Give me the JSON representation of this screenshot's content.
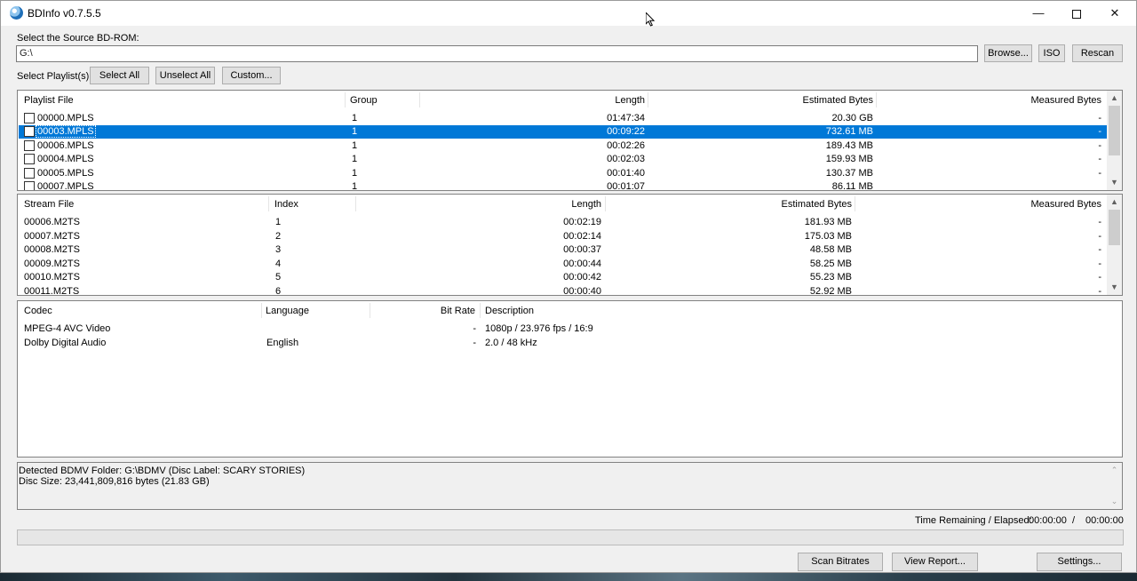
{
  "window": {
    "title": "BDInfo v0.7.5.5"
  },
  "source": {
    "label": "Select the Source BD-ROM:",
    "path": "G:\\",
    "browse_label": "Browse...",
    "iso_label": "ISO",
    "rescan_label": "Rescan"
  },
  "playlist_select": {
    "label": "Select Playlist(s):",
    "select_all": "Select All",
    "unselect_all": "Unselect All",
    "custom": "Custom..."
  },
  "playlists": {
    "headers": [
      "Playlist File",
      "Group",
      "Length",
      "Estimated Bytes",
      "Measured Bytes"
    ],
    "rows": [
      {
        "file": "00000.MPLS",
        "group": "1",
        "length": "01:47:34",
        "est": "20.30 GB",
        "meas": "-"
      },
      {
        "file": "00003.MPLS",
        "group": "1",
        "length": "00:09:22",
        "est": "732.61 MB",
        "meas": "-"
      },
      {
        "file": "00006.MPLS",
        "group": "1",
        "length": "00:02:26",
        "est": "189.43 MB",
        "meas": "-"
      },
      {
        "file": "00004.MPLS",
        "group": "1",
        "length": "00:02:03",
        "est": "159.93 MB",
        "meas": "-"
      },
      {
        "file": "00005.MPLS",
        "group": "1",
        "length": "00:01:40",
        "est": "130.37 MB",
        "meas": "-"
      },
      {
        "file": "00007.MPLS",
        "group": "1",
        "length": "00:01:07",
        "est": "86.11 MB",
        "meas": ""
      }
    ],
    "selected_index": 1
  },
  "streams": {
    "headers": [
      "Stream File",
      "Index",
      "Length",
      "Estimated Bytes",
      "Measured Bytes"
    ],
    "rows": [
      {
        "file": "00006.M2TS",
        "index": "1",
        "length": "00:02:19",
        "est": "181.93 MB",
        "meas": "-"
      },
      {
        "file": "00007.M2TS",
        "index": "2",
        "length": "00:02:14",
        "est": "175.03 MB",
        "meas": "-"
      },
      {
        "file": "00008.M2TS",
        "index": "3",
        "length": "00:00:37",
        "est": "48.58 MB",
        "meas": "-"
      },
      {
        "file": "00009.M2TS",
        "index": "4",
        "length": "00:00:44",
        "est": "58.25 MB",
        "meas": "-"
      },
      {
        "file": "00010.M2TS",
        "index": "5",
        "length": "00:00:42",
        "est": "55.23 MB",
        "meas": "-"
      },
      {
        "file": "00011.M2TS",
        "index": "6",
        "length": "00:00:40",
        "est": "52.92 MB",
        "meas": "-"
      }
    ]
  },
  "codecs": {
    "headers": [
      "Codec",
      "Language",
      "Bit Rate",
      "Description"
    ],
    "rows": [
      {
        "codec": "MPEG-4 AVC Video",
        "language": "",
        "bitrate": "-",
        "description": "1080p / 23.976 fps / 16:9"
      },
      {
        "codec": "Dolby Digital Audio",
        "language": "English",
        "bitrate": "-",
        "description": "2.0 / 48 kHz"
      }
    ]
  },
  "info": {
    "line1": "Detected BDMV Folder: G:\\BDMV (Disc Label: SCARY STORIES)",
    "line2": "Disc Size: 23,441,809,816 bytes (21.83 GB)"
  },
  "timer": {
    "label": "Time Remaining / Elapsed:",
    "remaining": "00:00:00",
    "separator": "/",
    "elapsed": "00:00:00"
  },
  "progress": 0,
  "buttons": {
    "scan_bitrates": "Scan Bitrates",
    "view_report": "View Report...",
    "settings": "Settings..."
  },
  "colors": {
    "selection": "#0078d7",
    "window": "#f0f0f0"
  }
}
